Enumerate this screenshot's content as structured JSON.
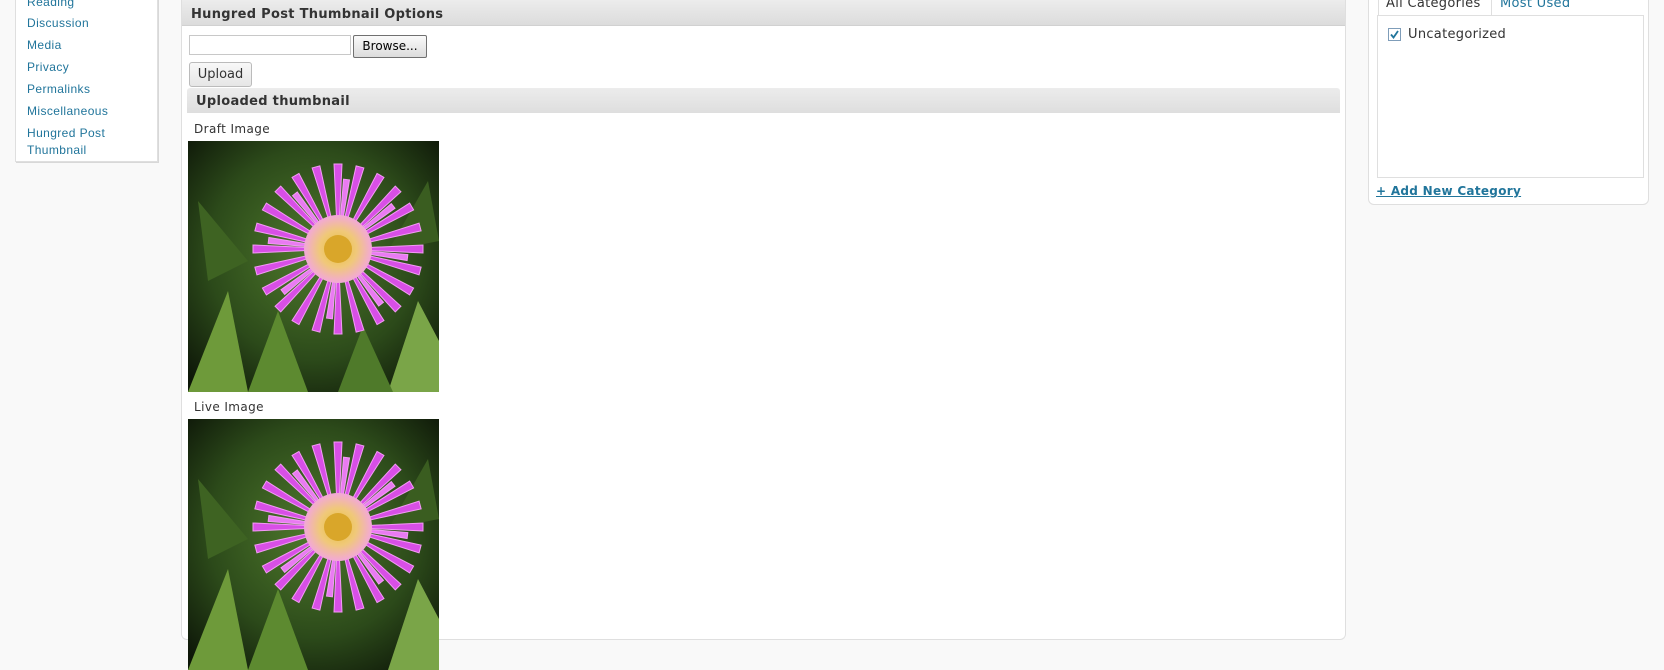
{
  "settings_menu": {
    "items": [
      {
        "label": "Reading"
      },
      {
        "label": "Discussion"
      },
      {
        "label": "Media"
      },
      {
        "label": "Privacy"
      },
      {
        "label": "Permalinks"
      },
      {
        "label": "Miscellaneous"
      },
      {
        "label": "Hungred Post Thumbnail"
      }
    ]
  },
  "thumbnail_box": {
    "title": "Hungred Post Thumbnail Options",
    "file_input_value": "",
    "browse_label": "Browse...",
    "upload_label": "Upload",
    "uploaded_heading": "Uploaded thumbnail",
    "draft_label": "Draft Image",
    "live_label": "Live Image",
    "image_icon": "flower-photo"
  },
  "categories_box": {
    "tabs": [
      {
        "label": "All Categories",
        "active": true
      },
      {
        "label": "Most Used",
        "active": false
      }
    ],
    "items": [
      {
        "label": "Uncategorized",
        "checked": true
      }
    ],
    "add_new_label": "+ Add New Category"
  },
  "colors": {
    "link": "#21759b",
    "text": "#333333",
    "background": "#f9f9f9"
  }
}
